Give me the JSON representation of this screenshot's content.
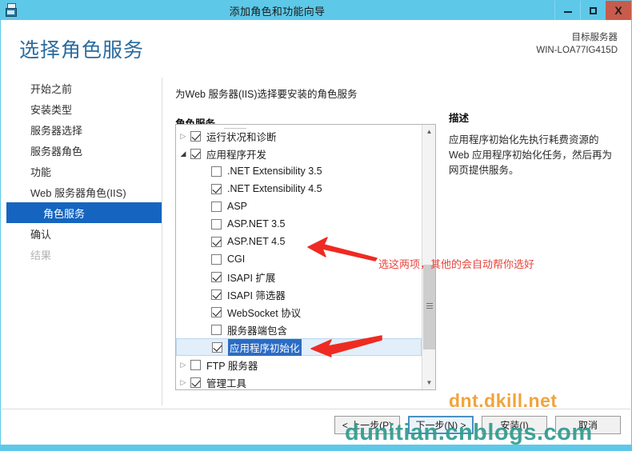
{
  "window": {
    "title": "添加角色和功能向导",
    "icon": "server-wizard-icon",
    "minimize_label": "最小化",
    "maximize_label": "最大化",
    "close_label": "X",
    "titlebar_color": "#5ec8e8",
    "close_color": "#c75b4c"
  },
  "header": {
    "page_title": "选择角色服务",
    "target_label": "目标服务器",
    "target_name": "WIN-LOA77IG415D"
  },
  "sidebar": {
    "items": [
      {
        "label": "开始之前",
        "state": "normal"
      },
      {
        "label": "安装类型",
        "state": "normal"
      },
      {
        "label": "服务器选择",
        "state": "normal"
      },
      {
        "label": "服务器角色",
        "state": "normal"
      },
      {
        "label": "功能",
        "state": "normal"
      },
      {
        "label": "Web 服务器角色(IIS)",
        "state": "normal"
      },
      {
        "label": "角色服务",
        "state": "selected"
      },
      {
        "label": "确认",
        "state": "normal"
      },
      {
        "label": "结果",
        "state": "disabled"
      }
    ],
    "selected_color": "#1565c0"
  },
  "main": {
    "intro": "为Web 服务器(IIS)选择要安装的角色服务",
    "section_label": "角色服务",
    "tree": [
      {
        "label": "运行状况和诊断",
        "checked": true,
        "level": 0,
        "twisty": "collapsed",
        "selected": false
      },
      {
        "label": "应用程序开发",
        "checked": true,
        "level": 0,
        "twisty": "expanded",
        "selected": false
      },
      {
        "label": ".NET Extensibility 3.5",
        "checked": false,
        "level": 1,
        "twisty": "none",
        "selected": false
      },
      {
        "label": ".NET Extensibility 4.5",
        "checked": true,
        "level": 1,
        "twisty": "none",
        "selected": false
      },
      {
        "label": "ASP",
        "checked": false,
        "level": 1,
        "twisty": "none",
        "selected": false
      },
      {
        "label": "ASP.NET 3.5",
        "checked": false,
        "level": 1,
        "twisty": "none",
        "selected": false
      },
      {
        "label": "ASP.NET 4.5",
        "checked": true,
        "level": 1,
        "twisty": "none",
        "selected": false
      },
      {
        "label": "CGI",
        "checked": false,
        "level": 1,
        "twisty": "none",
        "selected": false
      },
      {
        "label": "ISAPI 扩展",
        "checked": true,
        "level": 1,
        "twisty": "none",
        "selected": false
      },
      {
        "label": "ISAPI 筛选器",
        "checked": true,
        "level": 1,
        "twisty": "none",
        "selected": false
      },
      {
        "label": "WebSocket 协议",
        "checked": true,
        "level": 1,
        "twisty": "none",
        "selected": false
      },
      {
        "label": "服务器端包含",
        "checked": false,
        "level": 1,
        "twisty": "none",
        "selected": false
      },
      {
        "label": "应用程序初始化",
        "checked": true,
        "level": 1,
        "twisty": "none",
        "selected": true
      },
      {
        "label": "FTP 服务器",
        "checked": false,
        "level": 0,
        "twisty": "collapsed",
        "selected": false
      },
      {
        "label": "管理工具",
        "checked": true,
        "level": 0,
        "twisty": "collapsed",
        "selected": false
      }
    ],
    "scrollbar": {
      "up_arrow": "▲",
      "down_arrow": "▼"
    }
  },
  "description": {
    "title": "描述",
    "body": "应用程序初始化先执行耗费资源的 Web 应用程序初始化任务，然后再为网页提供服务。"
  },
  "annotations": {
    "note_text": "选这两项，其他的会自动帮你选好",
    "note_color": "#e8443c",
    "arrows": 2
  },
  "watermarks": {
    "orange": "dnt.dkill.net",
    "teal": "dunitian.cnblogs.com",
    "orange_color": "#f2a33c",
    "teal_color": "#2f9b8f"
  },
  "footer": {
    "buttons": [
      {
        "label": "< 上一步(P)",
        "default": false
      },
      {
        "label": "下一步(N) >",
        "default": true
      },
      {
        "label": "安装(I)",
        "default": false
      },
      {
        "label": "取消",
        "default": false
      }
    ]
  }
}
